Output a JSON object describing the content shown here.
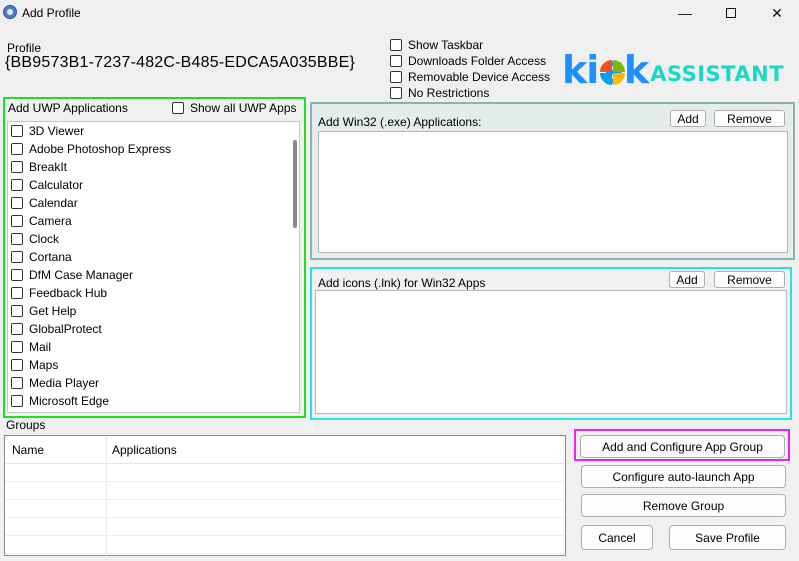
{
  "window": {
    "title": "Add Profile",
    "minimize": "—",
    "maximize": "",
    "close": "✕"
  },
  "profile": {
    "label": "Profile",
    "id": "{BB9573B1-7237-482C-B485-EDCA5A035BBE}"
  },
  "options": [
    {
      "label": "Show Taskbar",
      "checked": false
    },
    {
      "label": "Downloads Folder Access",
      "checked": false
    },
    {
      "label": "Removable Device Access",
      "checked": false
    },
    {
      "label": "No Restrictions",
      "checked": false
    }
  ],
  "logo": {
    "text_main": "ki",
    "text_s": "sk",
    "text_assist": "ASSISTANT"
  },
  "uwp": {
    "title": "Add UWP Applications",
    "show_all_label": "Show all UWP Apps",
    "apps": [
      "3D Viewer",
      "Adobe Photoshop Express",
      "BreakIt",
      "Calculator",
      "Calendar",
      "Camera",
      "Clock",
      "Cortana",
      "DfM Case Manager",
      "Feedback Hub",
      "Get Help",
      "GlobalProtect",
      "Mail",
      "Maps",
      "Media Player",
      "Microsoft Edge"
    ]
  },
  "win32": {
    "title": "Add Win32 (.exe) Applications:",
    "add": "Add",
    "remove": "Remove"
  },
  "lnk": {
    "title": "Add icons (.lnk) for Win32 Apps",
    "add": "Add",
    "remove": "Remove"
  },
  "groups": {
    "label": "Groups",
    "columns": [
      "Name",
      "Applications"
    ],
    "rows": []
  },
  "buttons": {
    "add_configure": "Add and Configure App Group",
    "configure_autolaunch": "Configure auto-launch App",
    "remove_group": "Remove Group",
    "cancel": "Cancel",
    "save": "Save Profile"
  },
  "colors": {
    "uwp_highlight": "#22dd22",
    "lnk_highlight": "#22e6e6",
    "button_highlight": "#ee22ee",
    "logo_blue": "#1e90ff",
    "logo_teal": "#18d9c8"
  }
}
